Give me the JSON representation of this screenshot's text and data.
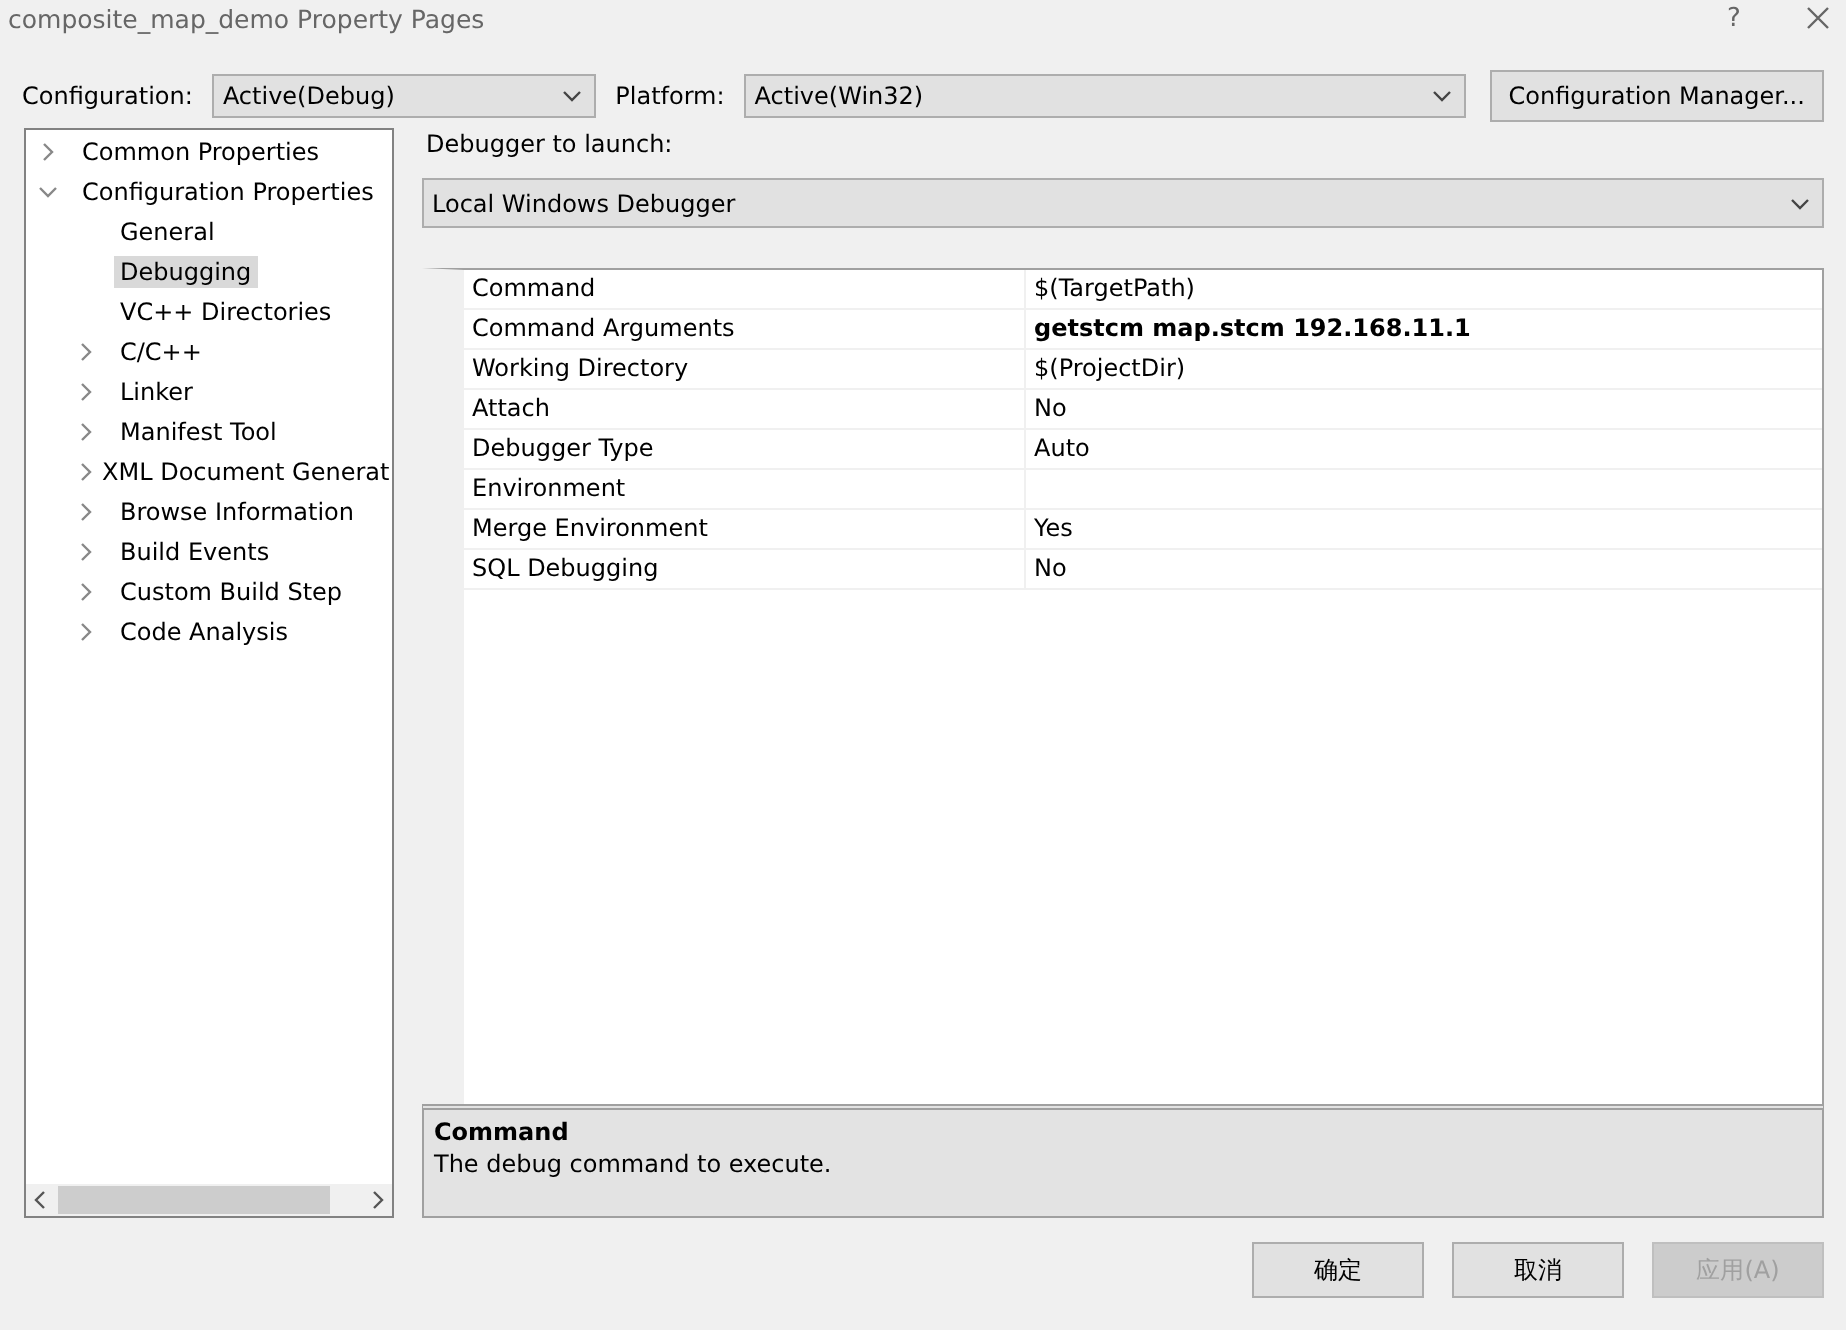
{
  "window": {
    "title": "composite_map_demo Property Pages",
    "help": "?"
  },
  "configuration": {
    "label": "Configuration:",
    "value": "Active(Debug)"
  },
  "platform": {
    "label": "Platform:",
    "value": "Active(Win32)"
  },
  "config_manager_button": "Configuration Manager...",
  "tree": [
    {
      "label": "Common Properties",
      "expanded": false,
      "selected": false
    },
    {
      "label": "Configuration Properties",
      "expanded": true,
      "selected": false,
      "children": [
        {
          "label": "General",
          "selected": false
        },
        {
          "label": "Debugging",
          "selected": true
        },
        {
          "label": "VC++ Directories",
          "selected": false
        },
        {
          "label": "C/C++",
          "expanded": false,
          "selected": false
        },
        {
          "label": "Linker",
          "expanded": false,
          "selected": false
        },
        {
          "label": "Manifest Tool",
          "expanded": false,
          "selected": false
        },
        {
          "label": "XML Document Generat",
          "expanded": false,
          "selected": false
        },
        {
          "label": "Browse Information",
          "expanded": false,
          "selected": false
        },
        {
          "label": "Build Events",
          "expanded": false,
          "selected": false
        },
        {
          "label": "Custom Build Step",
          "expanded": false,
          "selected": false
        },
        {
          "label": "Code Analysis",
          "expanded": false,
          "selected": false
        }
      ]
    }
  ],
  "debugger": {
    "label": "Debugger to launch:",
    "value": "Local Windows Debugger"
  },
  "properties": [
    {
      "name": "Command",
      "value": "$(TargetPath)",
      "bold": false
    },
    {
      "name": "Command Arguments",
      "value": "getstcm map.stcm 192.168.11.1",
      "bold": true
    },
    {
      "name": "Working Directory",
      "value": "$(ProjectDir)",
      "bold": false
    },
    {
      "name": "Attach",
      "value": "No",
      "bold": false
    },
    {
      "name": "Debugger Type",
      "value": "Auto",
      "bold": false
    },
    {
      "name": "Environment"
    },
    {
      "name": "Merge Environment",
      "value": "Yes",
      "bold": false
    },
    {
      "name": "SQL Debugging",
      "value": "No",
      "bold": false
    }
  ],
  "description": {
    "title": "Command",
    "text": "The debug command to execute."
  },
  "buttons": [
    {
      "label": "确定",
      "disabled": false
    },
    {
      "label": "取消",
      "disabled": false
    },
    {
      "label": "应用(A)",
      "disabled": true
    }
  ]
}
